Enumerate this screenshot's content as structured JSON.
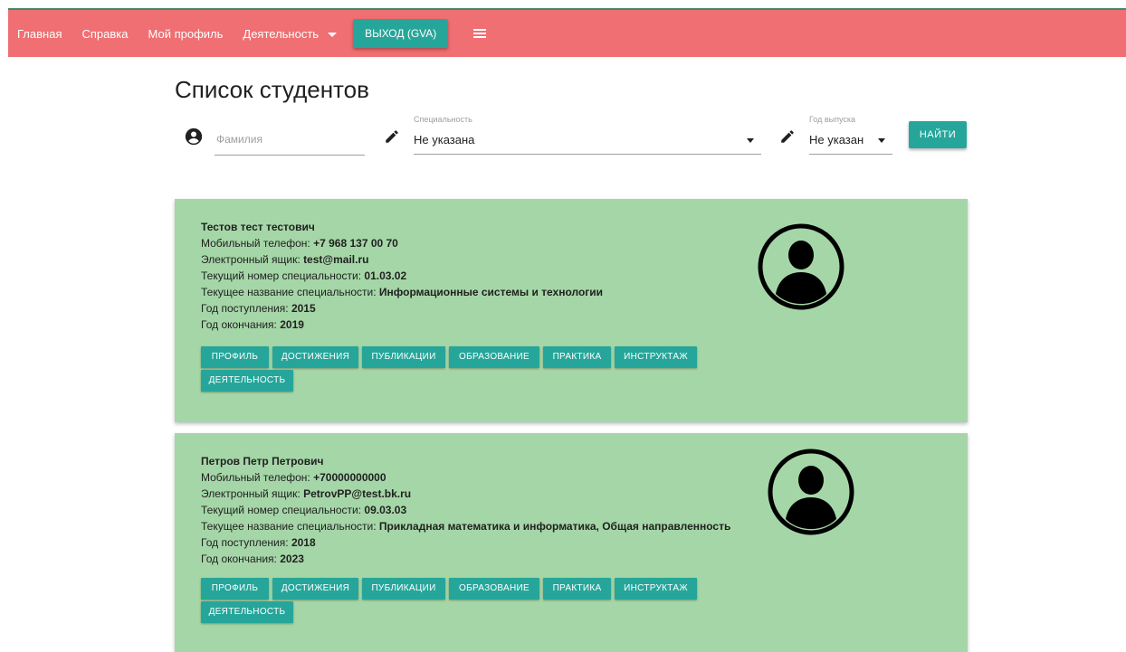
{
  "nav": {
    "home": "Главная",
    "help": "Справка",
    "profile": "Мой профиль",
    "activity": "Деятельность",
    "logout": "ВЫХОД (GVA)"
  },
  "page": {
    "title": "Список студентов"
  },
  "search": {
    "surname_placeholder": "Фамилия",
    "specialty_label": "Специальность",
    "specialty_value": "Не указана",
    "year_label": "Год выпуска",
    "year_value": "Не указан",
    "find_label": "НАЙТИ"
  },
  "field_labels": {
    "phone": "Мобильный телефон:",
    "email": "Электронный ящик:",
    "spec_num": "Текущий номер специальности:",
    "spec_name": "Текущее название специальности:",
    "year_in": "Год поступления:",
    "year_out": "Год окончания:"
  },
  "actions": {
    "profile": "ПРОФИЛЬ",
    "achievements": "ДОСТИЖЕНИЯ",
    "publications": "ПУБЛИКАЦИИ",
    "education": "ОБРАЗОВАНИЕ",
    "practice": "ПРАКТИКА",
    "briefing": "ИНСТРУКТАЖ",
    "activity": "ДЕЯТЕЛЬНОСТЬ"
  },
  "students": [
    {
      "name": "Тестов тест тестович",
      "phone": "+7 968 137 00 70",
      "email": "test@mail.ru",
      "spec_num": "01.03.02",
      "spec_name": "Информационные системы и технологии",
      "year_in": "2015",
      "year_out": "2019"
    },
    {
      "name": "Петров Петр Петрович",
      "phone": "+70000000000",
      "email": "PetrovPP@test.bk.ru",
      "spec_num": "09.03.03",
      "spec_name": "Прикладная математика и информатика, Общая направленность",
      "year_in": "2018",
      "year_out": "2023"
    }
  ],
  "colors": {
    "navbar": "#ef6f72",
    "accent": "#26a69a",
    "card": "#a5d6a7"
  },
  "icons": [
    "menu-icon",
    "account-circle-icon",
    "pencil-icon",
    "dropdown-arrow-icon",
    "avatar-icon"
  ]
}
